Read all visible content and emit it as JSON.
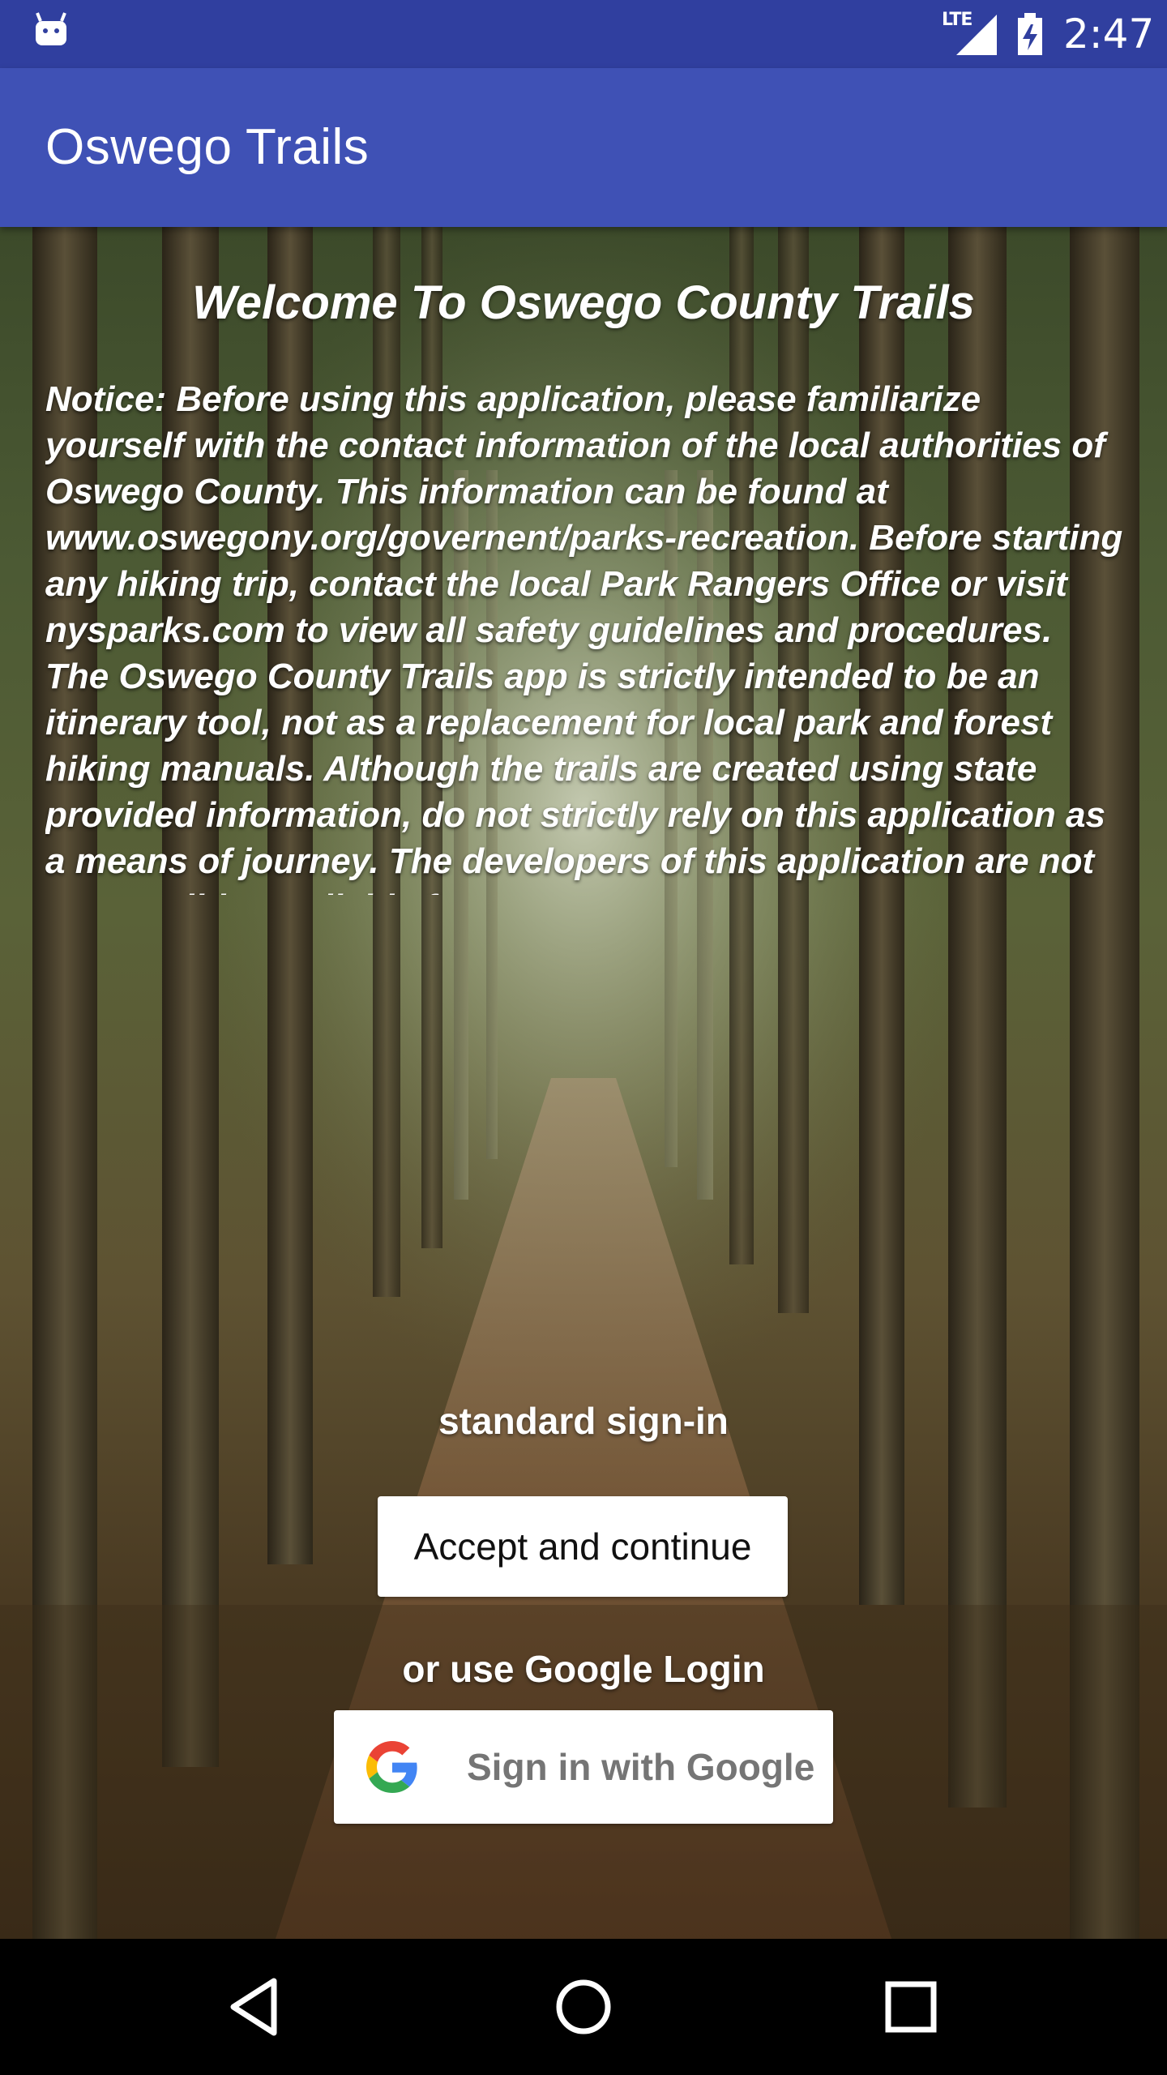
{
  "status_bar": {
    "time": "2:47",
    "network": "LTE",
    "icons": [
      "android-icon",
      "signal-icon",
      "battery-icon"
    ]
  },
  "app_bar": {
    "title": "Oswego Trails"
  },
  "main": {
    "welcome": "Welcome To Oswego County Trails",
    "notice": "Notice: Before using this application, please familiarize yourself with the contact information of the local authorities of Oswego County. This information can be found at www.oswegony.org/governent/parks-recreation. Before starting any hiking trip, contact the local Park Rangers Office or visit nysparks.com to view all safety guidelines and procedures. The Oswego County Trails app is strictly intended to be an itinerary tool, not as a replacement for local park and forest hiking manuals. Although the trails are created using state provided information, do not strictly rely on this application as a means of journey. The developers of this application are not responsible nor liable for any",
    "standard_label": "standard sign-in",
    "accept_button": "Accept and continue",
    "google_label": "or use Google Login",
    "google_button": "Sign in with Google"
  },
  "nav_bar": {
    "icons": [
      "back-icon",
      "home-icon",
      "recents-icon"
    ]
  },
  "colors": {
    "status_bar": "#303F9F",
    "app_bar": "#3F51B5"
  }
}
